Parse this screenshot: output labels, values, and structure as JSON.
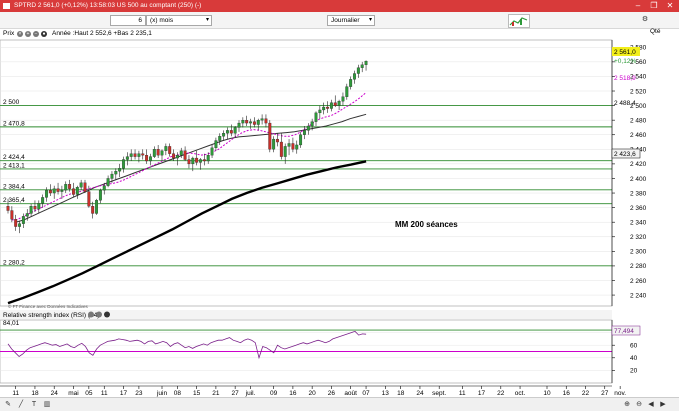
{
  "window": {
    "title": "SPTRD  2 561,0 (+0,12%)  13:58:03 US 500 au comptant (250) (-)",
    "minimize_label": "–",
    "maximize_label": "❐",
    "close_label": "✕"
  },
  "toolbar": {
    "period_value": "6",
    "period_unit": "(x) mois",
    "interval": "Journalier"
  },
  "legend": {
    "panel_label": "Prix",
    "stats": "Année :Haut 2 552,6 +Bas 2 235,1",
    "qty_label": "Qté"
  },
  "price_tags": {
    "last": "2 561,0",
    "change": "+0,12%",
    "ma20": "2 518,9",
    "ma50": "2 488,4",
    "ma200": "2 423,6"
  },
  "annotation": "MM 200 séances",
  "source_note": "© FT Finance avec Données Indicatives",
  "rsi": {
    "label": "Relative strength index (RSI) (14)",
    "level_label": "84,01",
    "value_tag": "77,494"
  },
  "colors": {
    "up": "#2e9a3a",
    "down": "#c8302a",
    "ma20": "#cc00cc",
    "ma50": "#333333",
    "ma200": "#000000",
    "support": "#2d8b2d",
    "rsi": "#7a1f8a",
    "last_tag": "#f2ee1a"
  },
  "chart_data": [
    {
      "type": "candlestick",
      "title": "SPTRD",
      "y_ticks": [
        2240,
        2260,
        2280,
        2300,
        2320,
        2340,
        2360,
        2380,
        2400,
        2420,
        2440,
        2460,
        2480,
        2500,
        2520,
        2540,
        2560,
        2580
      ],
      "y_tick_labels": [
        "2 240",
        "2 260",
        "2 280",
        "2 300",
        "2 320",
        "2 340",
        "2 360",
        "2 380",
        "2 400",
        "2 420",
        "2 440",
        "2 460",
        "2 480",
        "2 500",
        "2 520",
        "2 540",
        "2 560",
        "2 580"
      ],
      "ylim": [
        2225,
        2590
      ],
      "xlim": [
        0,
        143
      ],
      "x_ticks": [
        {
          "i": 2,
          "label": "11"
        },
        {
          "i": 7,
          "label": "18"
        },
        {
          "i": 12,
          "label": "24"
        },
        {
          "i": 17,
          "label": "mai"
        },
        {
          "i": 21,
          "label": "05"
        },
        {
          "i": 25,
          "label": "11"
        },
        {
          "i": 30,
          "label": "17"
        },
        {
          "i": 34,
          "label": "23"
        },
        {
          "i": 40,
          "label": "juin"
        },
        {
          "i": 44,
          "label": "08"
        },
        {
          "i": 49,
          "label": "15"
        },
        {
          "i": 54,
          "label": "21"
        },
        {
          "i": 59,
          "label": "27"
        },
        {
          "i": 63,
          "label": "juil."
        },
        {
          "i": 69,
          "label": "09"
        },
        {
          "i": 74,
          "label": "16"
        },
        {
          "i": 79,
          "label": "20"
        },
        {
          "i": 84,
          "label": "26"
        },
        {
          "i": 89,
          "label": "août"
        },
        {
          "i": 93,
          "label": "07"
        },
        {
          "i": 98,
          "label": "13"
        },
        {
          "i": 102,
          "label": "18"
        },
        {
          "i": 107,
          "label": "24"
        },
        {
          "i": 112,
          "label": "sept."
        },
        {
          "i": 118,
          "label": "11"
        },
        {
          "i": 123,
          "label": "17"
        },
        {
          "i": 128,
          "label": "22"
        },
        {
          "i": 133,
          "label": "oct."
        },
        {
          "i": 140,
          "label": "10"
        },
        {
          "i": 145,
          "label": "16"
        },
        {
          "i": 150,
          "label": "22"
        },
        {
          "i": 155,
          "label": "27"
        },
        {
          "i": 159,
          "label": "nov."
        }
      ],
      "horizontal_levels": [
        {
          "value": 2500,
          "label": "2 500"
        },
        {
          "value": 2470.8,
          "label": "2 470,8"
        },
        {
          "value": 2424.4,
          "label": "2 424,4"
        },
        {
          "value": 2413.1,
          "label": "2 413,1"
        },
        {
          "value": 2384.4,
          "label": "2 384,4"
        },
        {
          "value": 2365.4,
          "label": "2 365,4"
        },
        {
          "value": 2280.2,
          "label": "2 280,2"
        }
      ],
      "ohlc": [
        [
          2362,
          2372,
          2352,
          2356
        ],
        [
          2356,
          2362,
          2340,
          2344
        ],
        [
          2344,
          2350,
          2328,
          2334
        ],
        [
          2334,
          2342,
          2325,
          2338
        ],
        [
          2338,
          2352,
          2332,
          2348
        ],
        [
          2348,
          2358,
          2342,
          2352
        ],
        [
          2352,
          2365,
          2348,
          2362
        ],
        [
          2362,
          2370,
          2354,
          2358
        ],
        [
          2358,
          2370,
          2352,
          2366
        ],
        [
          2366,
          2378,
          2360,
          2374
        ],
        [
          2374,
          2388,
          2368,
          2384
        ],
        [
          2384,
          2392,
          2376,
          2380
        ],
        [
          2380,
          2390,
          2372,
          2386
        ],
        [
          2386,
          2394,
          2378,
          2382
        ],
        [
          2382,
          2390,
          2372,
          2384
        ],
        [
          2384,
          2396,
          2380,
          2392
        ],
        [
          2392,
          2398,
          2382,
          2386
        ],
        [
          2386,
          2394,
          2374,
          2378
        ],
        [
          2378,
          2390,
          2372,
          2388
        ],
        [
          2388,
          2398,
          2384,
          2394
        ],
        [
          2394,
          2398,
          2380,
          2382
        ],
        [
          2382,
          2390,
          2360,
          2362
        ],
        [
          2362,
          2368,
          2345,
          2352
        ],
        [
          2352,
          2372,
          2350,
          2370
        ],
        [
          2370,
          2386,
          2366,
          2384
        ],
        [
          2384,
          2394,
          2378,
          2390
        ],
        [
          2390,
          2404,
          2388,
          2400
        ],
        [
          2400,
          2410,
          2394,
          2406
        ],
        [
          2406,
          2414,
          2398,
          2410
        ],
        [
          2410,
          2420,
          2402,
          2414
        ],
        [
          2414,
          2430,
          2408,
          2426
        ],
        [
          2426,
          2436,
          2418,
          2430
        ],
        [
          2430,
          2440,
          2424,
          2434
        ],
        [
          2434,
          2440,
          2426,
          2430
        ],
        [
          2430,
          2438,
          2422,
          2434
        ],
        [
          2434,
          2440,
          2426,
          2432
        ],
        [
          2432,
          2440,
          2420,
          2424
        ],
        [
          2424,
          2434,
          2418,
          2430
        ],
        [
          2430,
          2444,
          2428,
          2440
        ],
        [
          2440,
          2446,
          2428,
          2432
        ],
        [
          2432,
          2440,
          2424,
          2438
        ],
        [
          2438,
          2448,
          2432,
          2444
        ],
        [
          2444,
          2448,
          2430,
          2434
        ],
        [
          2434,
          2440,
          2424,
          2428
        ],
        [
          2428,
          2436,
          2418,
          2432
        ],
        [
          2432,
          2442,
          2428,
          2438
        ],
        [
          2438,
          2444,
          2424,
          2426
        ],
        [
          2426,
          2432,
          2414,
          2420
        ],
        [
          2420,
          2430,
          2410,
          2428
        ],
        [
          2428,
          2438,
          2418,
          2422
        ],
        [
          2422,
          2428,
          2412,
          2426
        ],
        [
          2426,
          2434,
          2418,
          2424
        ],
        [
          2424,
          2436,
          2420,
          2432
        ],
        [
          2432,
          2446,
          2428,
          2442
        ],
        [
          2442,
          2456,
          2438,
          2452
        ],
        [
          2452,
          2462,
          2446,
          2458
        ],
        [
          2458,
          2466,
          2452,
          2462
        ],
        [
          2462,
          2470,
          2454,
          2466
        ],
        [
          2466,
          2474,
          2458,
          2462
        ],
        [
          2462,
          2472,
          2456,
          2470
        ],
        [
          2470,
          2480,
          2464,
          2476
        ],
        [
          2476,
          2484,
          2470,
          2480
        ],
        [
          2480,
          2486,
          2472,
          2476
        ],
        [
          2476,
          2482,
          2468,
          2478
        ],
        [
          2478,
          2484,
          2470,
          2474
        ],
        [
          2474,
          2482,
          2466,
          2480
        ],
        [
          2480,
          2488,
          2474,
          2482
        ],
        [
          2482,
          2488,
          2470,
          2476
        ],
        [
          2476,
          2480,
          2436,
          2440
        ],
        [
          2440,
          2458,
          2436,
          2454
        ],
        [
          2454,
          2462,
          2444,
          2450
        ],
        [
          2450,
          2462,
          2426,
          2430
        ],
        [
          2430,
          2448,
          2420,
          2444
        ],
        [
          2444,
          2454,
          2432,
          2448
        ],
        [
          2448,
          2456,
          2436,
          2440
        ],
        [
          2440,
          2452,
          2434,
          2446
        ],
        [
          2446,
          2464,
          2442,
          2460
        ],
        [
          2460,
          2472,
          2454,
          2466
        ],
        [
          2466,
          2476,
          2460,
          2472
        ],
        [
          2472,
          2482,
          2466,
          2478
        ],
        [
          2478,
          2492,
          2472,
          2490
        ],
        [
          2490,
          2500,
          2482,
          2494
        ],
        [
          2494,
          2504,
          2488,
          2498
        ],
        [
          2498,
          2506,
          2490,
          2496
        ],
        [
          2496,
          2508,
          2492,
          2504
        ],
        [
          2504,
          2514,
          2498,
          2500
        ],
        [
          2500,
          2508,
          2494,
          2506
        ],
        [
          2506,
          2518,
          2500,
          2512
        ],
        [
          2512,
          2530,
          2508,
          2526
        ],
        [
          2526,
          2540,
          2522,
          2536
        ],
        [
          2536,
          2548,
          2530,
          2544
        ],
        [
          2544,
          2556,
          2538,
          2552
        ],
        [
          2552,
          2560,
          2546,
          2556
        ],
        [
          2556,
          2562,
          2548,
          2561
        ]
      ],
      "ma_series": [
        {
          "name": "MM 20",
          "style": "dotted",
          "start": 1,
          "values": [
            2343,
            2344,
            2348,
            2352,
            2356,
            2360,
            2364,
            2368,
            2372,
            2376,
            2379,
            2381,
            2383,
            2386,
            2388,
            2390,
            2392,
            2393,
            2395,
            2398,
            2402,
            2406,
            2410,
            2414,
            2418,
            2422,
            2426,
            2430,
            2432,
            2434,
            2435,
            2434,
            2432,
            2433,
            2436,
            2440,
            2446,
            2452,
            2458,
            2463,
            2466,
            2467,
            2466,
            2464,
            2462,
            2460,
            2458,
            2458,
            2460,
            2464,
            2470,
            2476,
            2481,
            2484,
            2486,
            2490,
            2495,
            2500,
            2505,
            2511,
            2518
          ]
        },
        {
          "name": "MM 50",
          "style": "solid",
          "start": 2,
          "values": [
            2340,
            2343,
            2348,
            2353,
            2358,
            2363,
            2368,
            2373,
            2378,
            2383,
            2388,
            2392,
            2396,
            2400,
            2404,
            2408,
            2412,
            2416,
            2420,
            2424,
            2428,
            2432,
            2436,
            2440,
            2444,
            2448,
            2452,
            2455,
            2457,
            2458,
            2459,
            2460,
            2461,
            2462,
            2463,
            2464,
            2466,
            2468,
            2470,
            2472,
            2475,
            2478,
            2482,
            2485,
            2488
          ]
        },
        {
          "name": "MM 200",
          "style": "bold",
          "start": 0,
          "values": [
            2229,
            2236,
            2244,
            2252,
            2261,
            2270,
            2280,
            2290,
            2300,
            2310,
            2320,
            2330,
            2341,
            2352,
            2362,
            2372,
            2380,
            2387,
            2393,
            2399,
            2405,
            2410,
            2415,
            2419,
            2423.6
          ]
        }
      ]
    },
    {
      "type": "line",
      "title": "Relative strength index (RSI) (14)",
      "y_ticks": [
        20,
        40,
        60,
        80
      ],
      "y_tick_labels": [
        "20",
        "40",
        "60",
        "80"
      ],
      "ylim": [
        0,
        100
      ],
      "levels": [
        84.01,
        50
      ],
      "values": [
        62,
        54,
        48,
        42,
        46,
        52,
        56,
        58,
        60,
        62,
        64,
        62,
        60,
        61,
        58,
        60,
        62,
        58,
        56,
        60,
        63,
        58,
        48,
        44,
        54,
        60,
        63,
        66,
        67,
        68,
        70,
        69,
        68,
        66,
        67,
        68,
        66,
        62,
        66,
        67,
        62,
        64,
        66,
        64,
        58,
        62,
        64,
        60,
        56,
        58,
        55,
        58,
        60,
        62,
        60,
        64,
        66,
        68,
        68,
        70,
        72,
        68,
        66,
        64,
        68,
        70,
        68,
        64,
        40,
        58,
        56,
        52,
        48,
        60,
        56,
        54,
        56,
        58,
        60,
        62,
        64,
        62,
        64,
        66,
        68,
        66,
        64,
        66,
        70,
        72,
        74,
        76,
        78,
        80,
        82,
        76,
        78,
        77.494
      ]
    }
  ]
}
